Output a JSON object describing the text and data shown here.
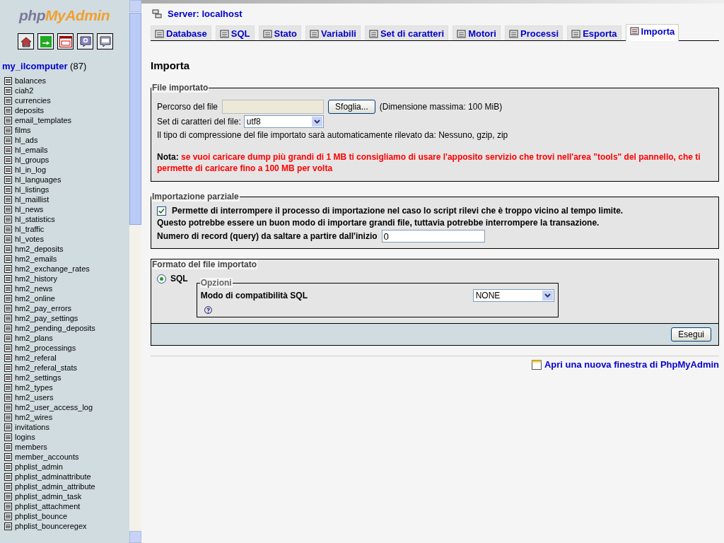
{
  "logo": {
    "part1": "php",
    "part2": "MyAdmin"
  },
  "database": {
    "name": "my_ilcomputer",
    "count": "(87)"
  },
  "tables": [
    "balances",
    "ciah2",
    "currencies",
    "deposits",
    "email_templates",
    "films",
    "hl_ads",
    "hl_emails",
    "hl_groups",
    "hl_in_log",
    "hl_languages",
    "hl_listings",
    "hl_maillist",
    "hl_news",
    "hl_statistics",
    "hl_traffic",
    "hl_votes",
    "hm2_deposits",
    "hm2_emails",
    "hm2_exchange_rates",
    "hm2_history",
    "hm2_news",
    "hm2_online",
    "hm2_pay_errors",
    "hm2_pay_settings",
    "hm2_pending_deposits",
    "hm2_plans",
    "hm2_processings",
    "hm2_referal",
    "hm2_referal_stats",
    "hm2_settings",
    "hm2_types",
    "hm2_users",
    "hm2_user_access_log",
    "hm2_wires",
    "invitations",
    "logins",
    "members",
    "member_accounts",
    "phplist_admin",
    "phplist_adminattribute",
    "phplist_admin_attribute",
    "phplist_admin_task",
    "phplist_attachment",
    "phplist_bounce",
    "phplist_bounceregex"
  ],
  "server": "Server: localhost",
  "tabs": [
    {
      "label": "Database",
      "selected": false
    },
    {
      "label": "SQL",
      "selected": false
    },
    {
      "label": "Stato",
      "selected": false
    },
    {
      "label": "Variabili",
      "selected": false
    },
    {
      "label": "Set di caratteri",
      "selected": false
    },
    {
      "label": "Motori",
      "selected": false
    },
    {
      "label": "Processi",
      "selected": false
    },
    {
      "label": "Esporta",
      "selected": false
    },
    {
      "label": "Importa",
      "selected": true
    }
  ],
  "heading": "Importa",
  "file_section": {
    "legend": "File importato",
    "path_label": "Percorso del file",
    "browse_button": "Sfoglia...",
    "max_size": "(Dimensione massima: 100 MiB)",
    "charset_label": "Set di caratteri del file:",
    "charset_value": "utf8",
    "compression_note": "Il tipo di compressione del file importato sarà automaticamente rilevato da: Nessuno, gzip, zip",
    "note_label": "Nota:",
    "note_text": "se vuoi caricare dump più grandi di 1 MB ti consigliamo di usare l'apposito servizio che trovi nell'area \"tools\" del pannello, che ti permette di caricare fino a 100 MB per volta"
  },
  "partial_section": {
    "legend": "Importazione parziale",
    "allow_interrupt": {
      "label": "Permette di interrompere il processo di importazione nel caso lo script rilevi che è troppo vicino al tempo limite.",
      "checked": true
    },
    "hint": "Questo potrebbe essere un buon modo di importare grandi file, tuttavia potrebbe interrompere la transazione.",
    "skip_label": "Numero di record (query) da saltare a partire dall'inizio",
    "skip_value": "0"
  },
  "format_section": {
    "legend": "Formato del file importato",
    "formats": [
      {
        "label": "SQL",
        "selected": true
      }
    ],
    "options_legend": "Opzioni",
    "compat_label": "Modo di compatibilità SQL",
    "compat_value": "NONE"
  },
  "submit_button": "Esegui",
  "new_window_link": "Apri una nuova finestra di PhpMyAdmin"
}
